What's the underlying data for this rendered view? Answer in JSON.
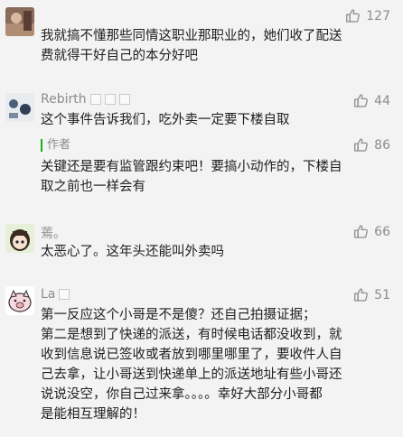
{
  "comments": [
    {
      "username": "",
      "likes": "127",
      "lines": [
        "我就搞不懂那些同情这职业那职业的，她们收了配送",
        "费就得干好自己的本分好吧"
      ]
    },
    {
      "username": "Rebirth",
      "likes": "44",
      "lines": [
        "这个事件告诉我们，吃外卖一定要下楼自取"
      ],
      "reply": {
        "tag": "作者",
        "likes": "86",
        "lines": [
          "关键还是要有监管跟约束吧！要搞小动作的，下楼自",
          "取之前也一样会有"
        ]
      }
    },
    {
      "username": "蔫。",
      "likes": "66",
      "lines": [
        "太恶心了。这年头还能叫外卖吗"
      ]
    },
    {
      "username": "La",
      "likes": "51",
      "lines": [
        "第一反应这个小哥是不是傻？还自己拍摄证据；",
        "第二是想到了快递的派送，有时候电话都没收到，就",
        "收到信息说已签收或者放到哪里哪里了，要收件人自",
        "己去拿，让小哥送到快递单上的派送地址有些小哥还",
        "说说没空，你自己过来拿。。。。幸好大部分小哥都",
        "是能相互理解的！"
      ]
    }
  ],
  "icons": {
    "like": "thumbs-up-icon"
  }
}
